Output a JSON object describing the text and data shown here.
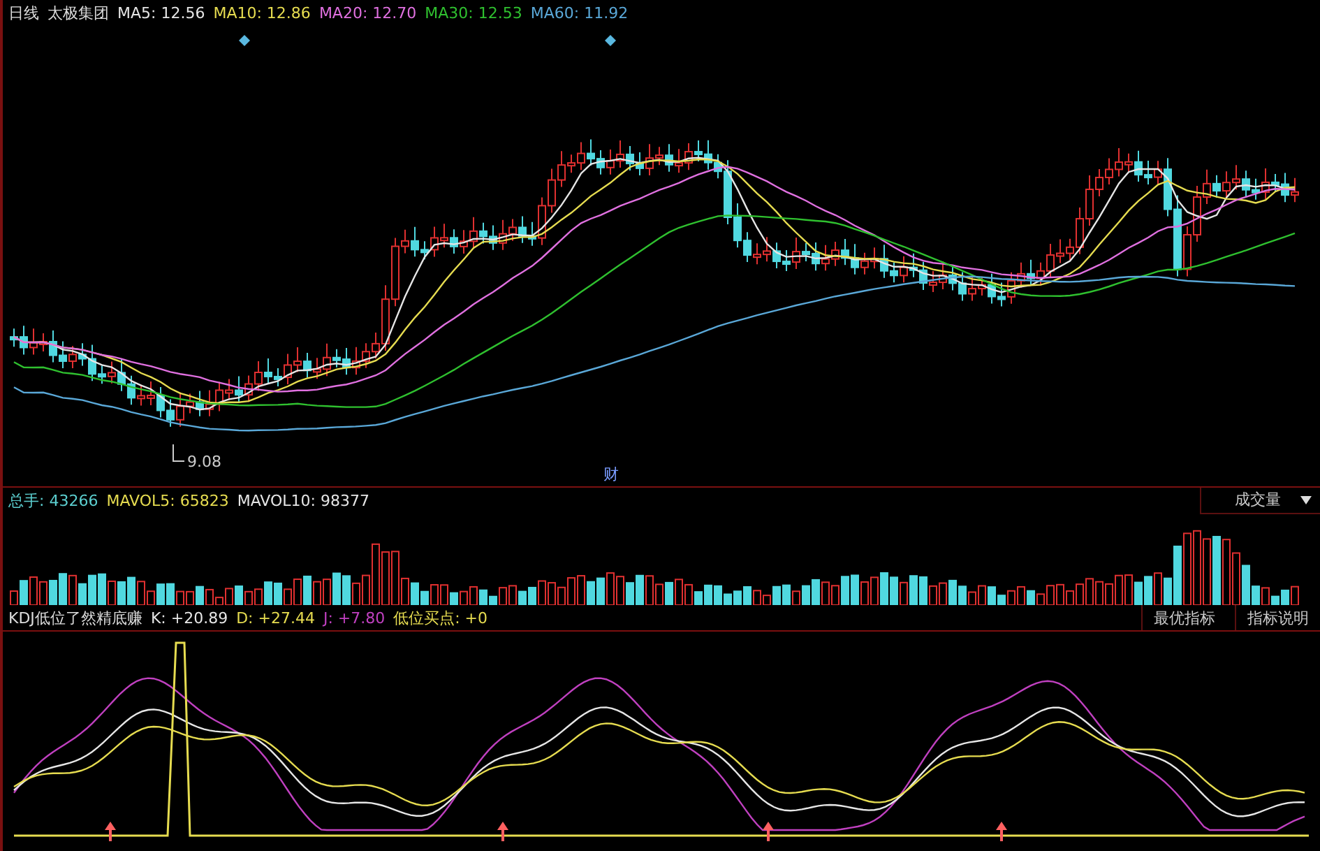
{
  "header": {
    "period": "日线",
    "stock": "太极集团",
    "averages": [
      {
        "label": "MA5:",
        "value": "12.56",
        "color": "#e6e6e6"
      },
      {
        "label": "MA10:",
        "value": "12.86",
        "color": "#e6dc50"
      },
      {
        "label": "MA20:",
        "value": "12.70",
        "color": "#e070e0"
      },
      {
        "label": "MA30:",
        "value": "12.53",
        "color": "#2fc02f"
      },
      {
        "label": "MA60:",
        "value": "11.92",
        "color": "#5aa8d8"
      }
    ]
  },
  "price_chart": {
    "low_label": "9.08",
    "marker": "财"
  },
  "volume": {
    "readings": [
      {
        "label": "总手:",
        "value": "43266",
        "color": "#5ccfd0"
      },
      {
        "label": "MAVOL5:",
        "value": "65823",
        "color": "#e6dc50"
      },
      {
        "label": "MAVOL10:",
        "value": "98377",
        "color": "#e6e6e6"
      }
    ],
    "selector": "成交量"
  },
  "kdj": {
    "title": "KDJ低位了然精底赚",
    "readings": [
      {
        "label": "K:",
        "value": "+20.89",
        "color": "#e6e6e6"
      },
      {
        "label": "D:",
        "value": "+27.44",
        "color": "#e6dc50"
      },
      {
        "label": "J:",
        "value": "+7.80",
        "color": "#c040c0"
      },
      {
        "label": "低位买点:",
        "value": "+0",
        "color": "#e6dc50"
      }
    ],
    "buttons": [
      "最优指标",
      "指标说明"
    ]
  }
}
